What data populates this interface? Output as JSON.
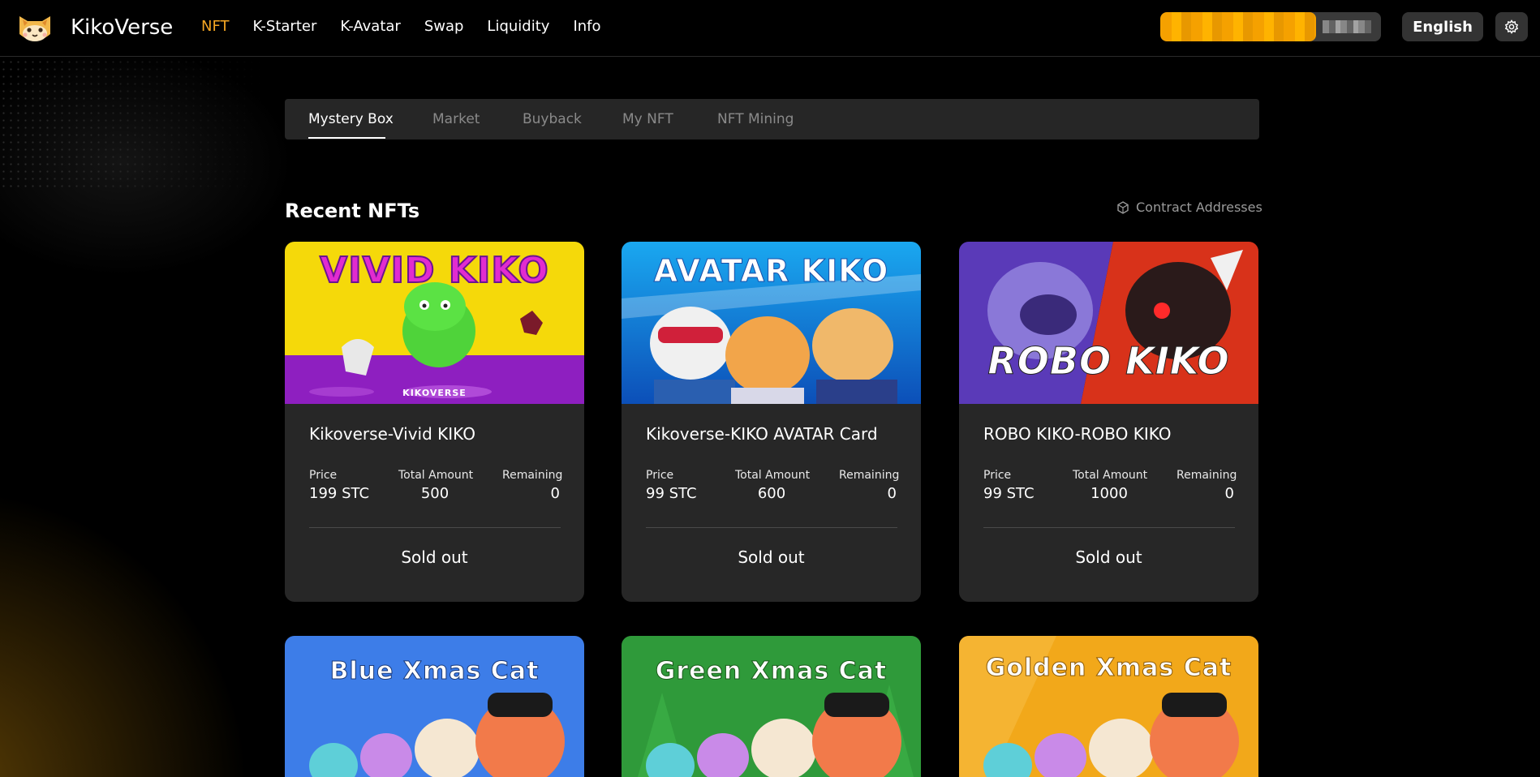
{
  "header": {
    "brand": "KikoVerse",
    "nav": [
      "NFT",
      "K-Starter",
      "K-Avatar",
      "Swap",
      "Liquidity",
      "Info"
    ],
    "active_nav": "NFT",
    "language": "English"
  },
  "tabs": [
    "Mystery Box",
    "Market",
    "Buyback",
    "My NFT",
    "NFT Mining"
  ],
  "active_tab": "Mystery Box",
  "section": {
    "title": "Recent NFTs",
    "contract_link": "Contract Addresses"
  },
  "labels": {
    "price": "Price",
    "total": "Total Amount",
    "remaining": "Remaining",
    "sold_out": "Sold out"
  },
  "cards": [
    {
      "art_title": "VIVID KIKO",
      "art_badge": "KIKOVERSE",
      "title": "Kikoverse-Vivid KIKO",
      "price": "199 STC",
      "total": "500",
      "remaining": "0",
      "status": "Sold out"
    },
    {
      "art_title": "AVATAR KIKO",
      "title": "Kikoverse-KIKO AVATAR Card",
      "price": "99 STC",
      "total": "600",
      "remaining": "0",
      "status": "Sold out"
    },
    {
      "art_title": "ROBO KIKO",
      "title": "ROBO KIKO-ROBO KIKO",
      "price": "99 STC",
      "total": "1000",
      "remaining": "0",
      "status": "Sold out"
    },
    {
      "art_title": "Blue Xmas Cat"
    },
    {
      "art_title": "Green Xmas Cat"
    },
    {
      "art_title": "Golden Xmas Cat"
    }
  ],
  "colors": {
    "accent": "#f5a623",
    "card_bg": "#272727",
    "tab_bg": "#262626",
    "page_bg": "#000000"
  }
}
